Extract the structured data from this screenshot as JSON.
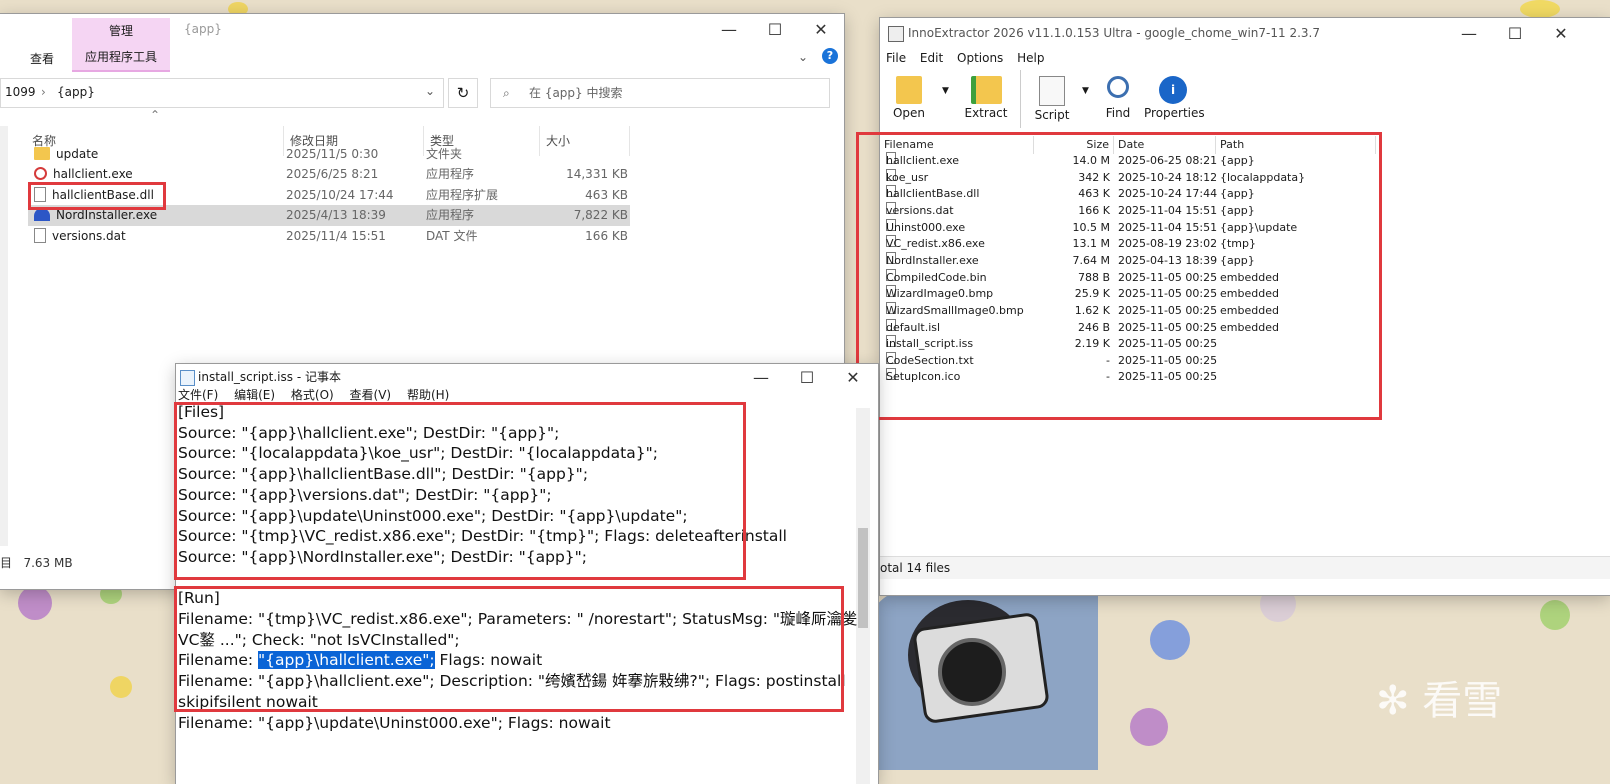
{
  "explorer": {
    "ribbon_tab_manage": "管理",
    "ribbon_tab_view": "查看",
    "ribbon_tab_app_tools": "应用程序工具",
    "title": "{app}",
    "address_prefix": "1099",
    "address_current": "{app}",
    "search_placeholder": "在 {app} 中搜索",
    "columns": {
      "name": "名称",
      "date": "修改日期",
      "type": "类型",
      "size": "大小"
    },
    "files": [
      {
        "name": "update",
        "date": "2025/11/5 0:30",
        "type": "文件夹",
        "size": "",
        "icon": "folder-icon"
      },
      {
        "name": "hallclient.exe",
        "date": "2025/6/25 8:21",
        "type": "应用程序",
        "size": "14,331 KB",
        "icon": "app-exe-icon"
      },
      {
        "name": "hallclientBase.dll",
        "date": "2025/10/24 17:44",
        "type": "应用程序扩展",
        "size": "463 KB",
        "icon": "dll-icon"
      },
      {
        "name": "NordInstaller.exe",
        "date": "2025/4/13 18:39",
        "type": "应用程序",
        "size": "7,822 KB",
        "icon": "nord-icon"
      },
      {
        "name": "versions.dat",
        "date": "2025/11/4 15:51",
        "type": "DAT 文件",
        "size": "166 KB",
        "icon": "file-icon"
      }
    ],
    "status_prefix": "目",
    "status_selected_size": "7.63 MB"
  },
  "inno": {
    "title": "InnoExtractor 2026 v11.1.0.153 Ultra - google_chome_win7-11 2.3.7",
    "menu": [
      "File",
      "Edit",
      "Options",
      "Help"
    ],
    "toolbar": {
      "open": "Open",
      "extract": "Extract",
      "script": "Script",
      "find": "Find",
      "properties": "Properties"
    },
    "columns": {
      "filename": "Filename",
      "size": "Size",
      "date": "Date",
      "path": "Path"
    },
    "rows": [
      {
        "filename": "hallclient.exe",
        "size": "14.0 M",
        "date": "2025-06-25 08:21",
        "path": "{app}"
      },
      {
        "filename": "koe_usr",
        "size": "342 K",
        "date": "2025-10-24 18:12",
        "path": "{localappdata}"
      },
      {
        "filename": "hallclientBase.dll",
        "size": "463 K",
        "date": "2025-10-24 17:44",
        "path": "{app}"
      },
      {
        "filename": "versions.dat",
        "size": "166 K",
        "date": "2025-11-04 15:51",
        "path": "{app}"
      },
      {
        "filename": "Uninst000.exe",
        "size": "10.5 M",
        "date": "2025-11-04 15:51",
        "path": "{app}\\update"
      },
      {
        "filename": "VC_redist.x86.exe",
        "size": "13.1 M",
        "date": "2025-08-19 23:02",
        "path": "{tmp}"
      },
      {
        "filename": "NordInstaller.exe",
        "size": "7.64 M",
        "date": "2025-04-13 18:39",
        "path": "{app}"
      },
      {
        "filename": "CompiledCode.bin",
        "size": "788 B",
        "date": "2025-11-05 00:25",
        "path": "embedded"
      },
      {
        "filename": "WizardImage0.bmp",
        "size": "25.9 K",
        "date": "2025-11-05 00:25",
        "path": "embedded"
      },
      {
        "filename": "WizardSmallImage0.bmp",
        "size": "1.62 K",
        "date": "2025-11-05 00:25",
        "path": "embedded"
      },
      {
        "filename": "default.isl",
        "size": "246 B",
        "date": "2025-11-05 00:25",
        "path": "embedded"
      },
      {
        "filename": "install_script.iss",
        "size": "2.19 K",
        "date": "2025-11-05 00:25",
        "path": ""
      },
      {
        "filename": "CodeSection.txt",
        "size": "-",
        "date": "2025-11-05 00:25",
        "path": ""
      },
      {
        "filename": "SetupIcon.ico",
        "size": "-",
        "date": "2025-11-05 00:25",
        "path": ""
      }
    ],
    "status": "otal 14 files"
  },
  "notepad": {
    "title": "install_script.iss - 记事本",
    "menu": [
      "文件(F)",
      "编辑(E)",
      "格式(O)",
      "查看(V)",
      "帮助(H)"
    ],
    "lines": [
      "[Files]",
      "Source: \"{app}\\hallclient.exe\"; DestDir: \"{app}\";",
      "Source: \"{localappdata}\\koe_usr\"; DestDir: \"{localappdata}\";",
      "Source: \"{app}\\hallclientBase.dll\"; DestDir: \"{app}\";",
      "Source: \"{app}\\versions.dat\"; DestDir: \"{app}\";",
      "Source: \"{app}\\update\\Uninst000.exe\"; DestDir: \"{app}\\update\";",
      "Source: \"{tmp}\\VC_redist.x86.exe\"; DestDir: \"{tmp}\"; Flags: deleteafterinstall",
      "Source: \"{app}\\NordInstaller.exe\"; DestDir: \"{app}\";",
      "",
      "[Run]",
      "Filename: \"{tmp}\\VC_redist.x86.exe\"; Parameters: \" /norestart\"; StatusMsg: \"璇峰厛瀹夎",
      "   VC鐜       ...\"; Check: \"not IsVCInstalled\";",
      "",
      "Filename: \"{app}\\hallclient.exe\"; Description: \"绔嬪嵆鍚    姩搴旂敤绋?\"; Flags: postinstall",
      "skipifsilent nowait",
      "Filename: \"{app}\\update\\Uninst000.exe\"; Flags: nowait"
    ],
    "sel_line_prefix": "Filename: ",
    "sel_line_selected": "\"{app}\\hallclient.exe\";",
    "sel_line_suffix": " Flags: nowait"
  },
  "watermark": "看雪"
}
